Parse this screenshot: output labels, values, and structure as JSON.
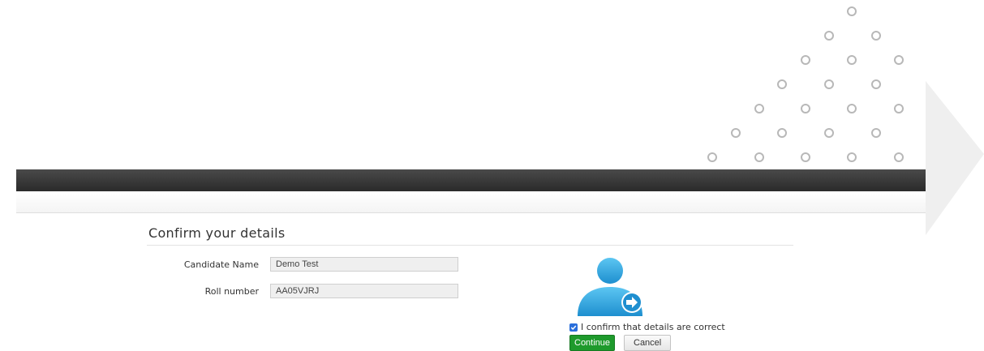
{
  "page": {
    "title": "Confirm your details"
  },
  "fields": [
    {
      "label": "Candidate Name",
      "value": "Demo Test"
    },
    {
      "label": "Roll number",
      "value": "AA05VJRJ"
    }
  ],
  "confirm": {
    "checked": true,
    "label": "I confirm that details are correct"
  },
  "buttons": {
    "continue_label": "Continue",
    "cancel_label": "Cancel"
  },
  "icons": {
    "avatar": "user-login-icon",
    "decor": "dot-pattern",
    "arrow": "chevron-arrow-background"
  },
  "colors": {
    "header_bar": "#333333",
    "continue_button": "#1e9a2c",
    "avatar_blue": "#3ab0e8",
    "checkbox": "#2a6fdb"
  }
}
